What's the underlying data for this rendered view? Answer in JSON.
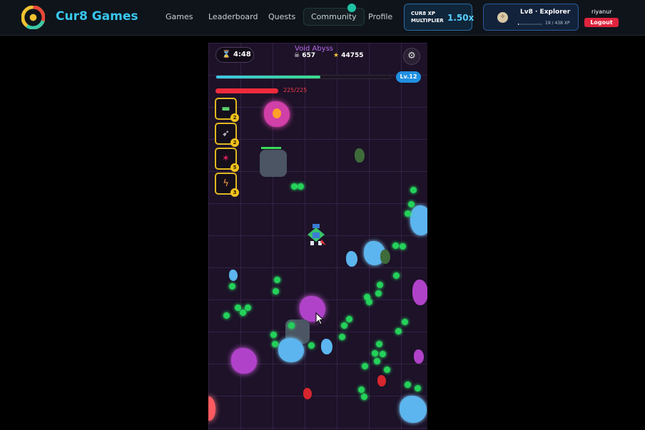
{
  "app": {
    "brand": "Cur8 Games",
    "accent_color": "#38c7ee"
  },
  "nav": {
    "items": [
      "Games",
      "Leaderboard",
      "Quests",
      "Community",
      "Profile"
    ],
    "active": "Community"
  },
  "xp_multiplier": {
    "label_line1": "CUR8 XP",
    "label_line2": "MULTIPLIER",
    "value": "1.50x"
  },
  "user_level": {
    "title": "Lv8 · Explorer",
    "xp_text": "19 / 438 XP",
    "xp_fraction": 0.043,
    "avatar_icon": "compass-icon"
  },
  "user": {
    "name": "riyanur",
    "logout_label": "Logout"
  },
  "game": {
    "timer": "4:48",
    "stage_name": "Void Abyss",
    "kills": "657",
    "score": "44755",
    "level_badge": "Lv.12",
    "xp_fraction": 0.6,
    "hp_text": "225/225",
    "hp_fraction": 1.0,
    "weapons": [
      {
        "icon": "blaster-icon",
        "glyph": "▬",
        "level": "2",
        "color": "#5ad06e"
      },
      {
        "icon": "rocket-icon",
        "glyph": "🚀",
        "level": "2",
        "color": "#e8e8e8"
      },
      {
        "icon": "burst-icon",
        "glyph": "✶",
        "level": "5",
        "color": "#e0245e"
      },
      {
        "icon": "lightning-icon",
        "glyph": "⚡",
        "level": "3",
        "color": "#ff9a3c"
      }
    ]
  }
}
